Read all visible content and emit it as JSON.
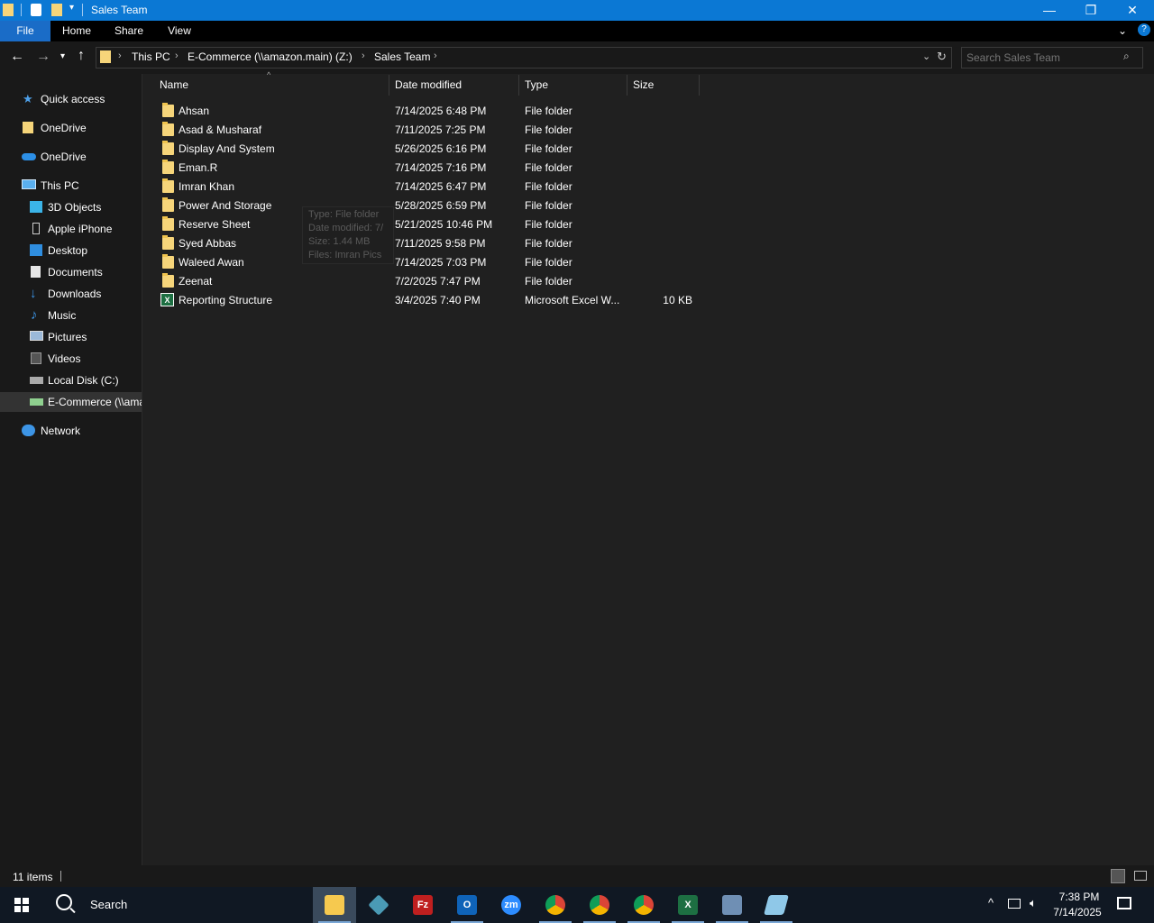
{
  "window": {
    "title": "Sales Team",
    "controls": {
      "minimize": "—",
      "maximize": "❐",
      "close": "✕"
    }
  },
  "ribbon": {
    "tabs": [
      "File",
      "Home",
      "Share",
      "View"
    ]
  },
  "address": {
    "crumbs": [
      "This PC",
      "E-Commerce (\\\\amazon.main) (Z:)",
      "Sales Team"
    ],
    "search_placeholder": "Search Sales Team"
  },
  "sidebar": {
    "quick_access": "Quick access",
    "onedrive_1": "OneDrive",
    "onedrive_2": "OneDrive",
    "this_pc": "This PC",
    "items": [
      "3D Objects",
      "Apple iPhone",
      "Desktop",
      "Documents",
      "Downloads",
      "Music",
      "Pictures",
      "Videos",
      "Local Disk (C:)",
      "E-Commerce (\\\\amazon.main) (Z:)"
    ],
    "network": "Network"
  },
  "columns": {
    "name": "Name",
    "date": "Date modified",
    "type": "Type",
    "size": "Size"
  },
  "files": [
    {
      "name": "Ahsan",
      "date": "7/14/2025 6:48 PM",
      "type": "File folder",
      "size": ""
    },
    {
      "name": "Asad & Musharaf",
      "date": "7/11/2025 7:25 PM",
      "type": "File folder",
      "size": ""
    },
    {
      "name": "Display And System",
      "date": "5/26/2025 6:16 PM",
      "type": "File folder",
      "size": ""
    },
    {
      "name": "Eman.R",
      "date": "7/14/2025 7:16 PM",
      "type": "File folder",
      "size": ""
    },
    {
      "name": "Imran Khan",
      "date": "7/14/2025 6:47 PM",
      "type": "File folder",
      "size": ""
    },
    {
      "name": "Power And Storage",
      "date": "5/28/2025 6:59 PM",
      "type": "File folder",
      "size": ""
    },
    {
      "name": "Reserve Sheet",
      "date": "5/21/2025 10:46 PM",
      "type": "File folder",
      "size": ""
    },
    {
      "name": "Syed Abbas",
      "date": "7/11/2025 9:58 PM",
      "type": "File folder",
      "size": ""
    },
    {
      "name": "Waleed Awan",
      "date": "7/14/2025 7:03 PM",
      "type": "File folder",
      "size": ""
    },
    {
      "name": "Zeenat",
      "date": "7/2/2025 7:47 PM",
      "type": "File folder",
      "size": ""
    },
    {
      "name": "Reporting Structure",
      "date": "3/4/2025 7:40 PM",
      "type": "Microsoft Excel W...",
      "size": "10 KB"
    }
  ],
  "tooltip": [
    "Type: File folder",
    "Date modified: 7/",
    "Size: 1.44 MB",
    "Files: Imran Pics"
  ],
  "status": {
    "count": "11 items"
  },
  "taskbar": {
    "search": "Search",
    "time": "7:38 PM",
    "date": "7/14/2025",
    "zoom_label": "zm",
    "ftp_label": "Fz",
    "outlook_label": "O",
    "excel_label": "X"
  },
  "colors": {
    "accent": "#0b78d4",
    "folder": "#f6d57a",
    "background": "#202020"
  }
}
